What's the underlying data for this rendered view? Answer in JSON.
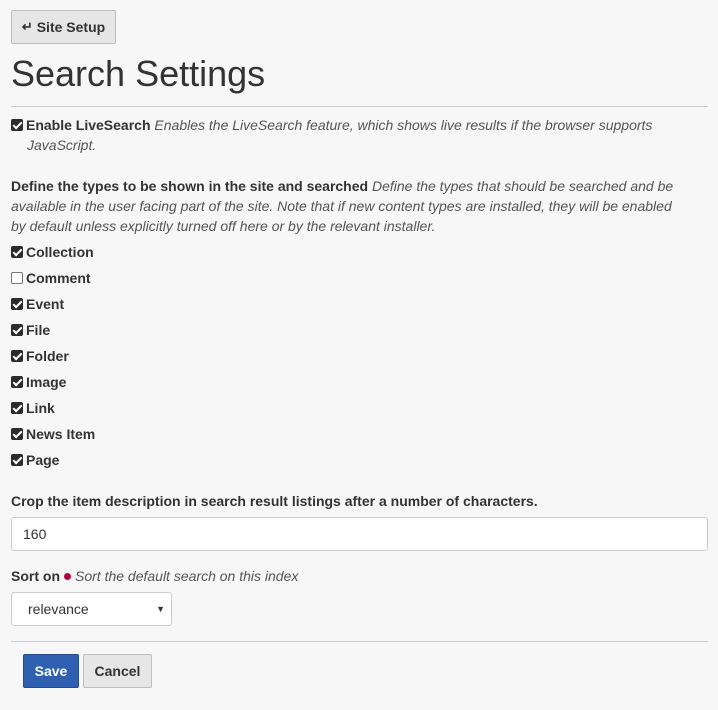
{
  "header": {
    "back_button_label": "Site Setup",
    "back_icon": "return-arrow-icon",
    "page_title": "Search Settings"
  },
  "livesearch": {
    "checked": true,
    "label": "Enable LiveSearch",
    "help_line1": "Enables the LiveSearch feature, which shows live results if the browser supports",
    "help_line2": "JavaScript."
  },
  "types": {
    "label": "Define the types to be shown in the site and searched",
    "help_line1": "Define the types that should be searched and be",
    "help_line2": "available in the user facing part of the site. Note that if new content types are installed, they will be enabled",
    "help_line3": "by default unless explicitly turned off here or by the relevant installer.",
    "items": [
      {
        "label": "Collection",
        "checked": true
      },
      {
        "label": "Comment",
        "checked": false
      },
      {
        "label": "Event",
        "checked": true
      },
      {
        "label": "File",
        "checked": true
      },
      {
        "label": "Folder",
        "checked": true
      },
      {
        "label": "Image",
        "checked": true
      },
      {
        "label": "Link",
        "checked": true
      },
      {
        "label": "News Item",
        "checked": true
      },
      {
        "label": "Page",
        "checked": true
      }
    ]
  },
  "crop": {
    "label": "Crop the item description in search result listings after a number of characters.",
    "value": "160"
  },
  "sort": {
    "label": "Sort on",
    "help": "Sort the default search on this index",
    "selected": "relevance",
    "required_color": "#b5003b"
  },
  "actions": {
    "save_label": "Save",
    "cancel_label": "Cancel",
    "save_color": "#2f5fb0"
  }
}
